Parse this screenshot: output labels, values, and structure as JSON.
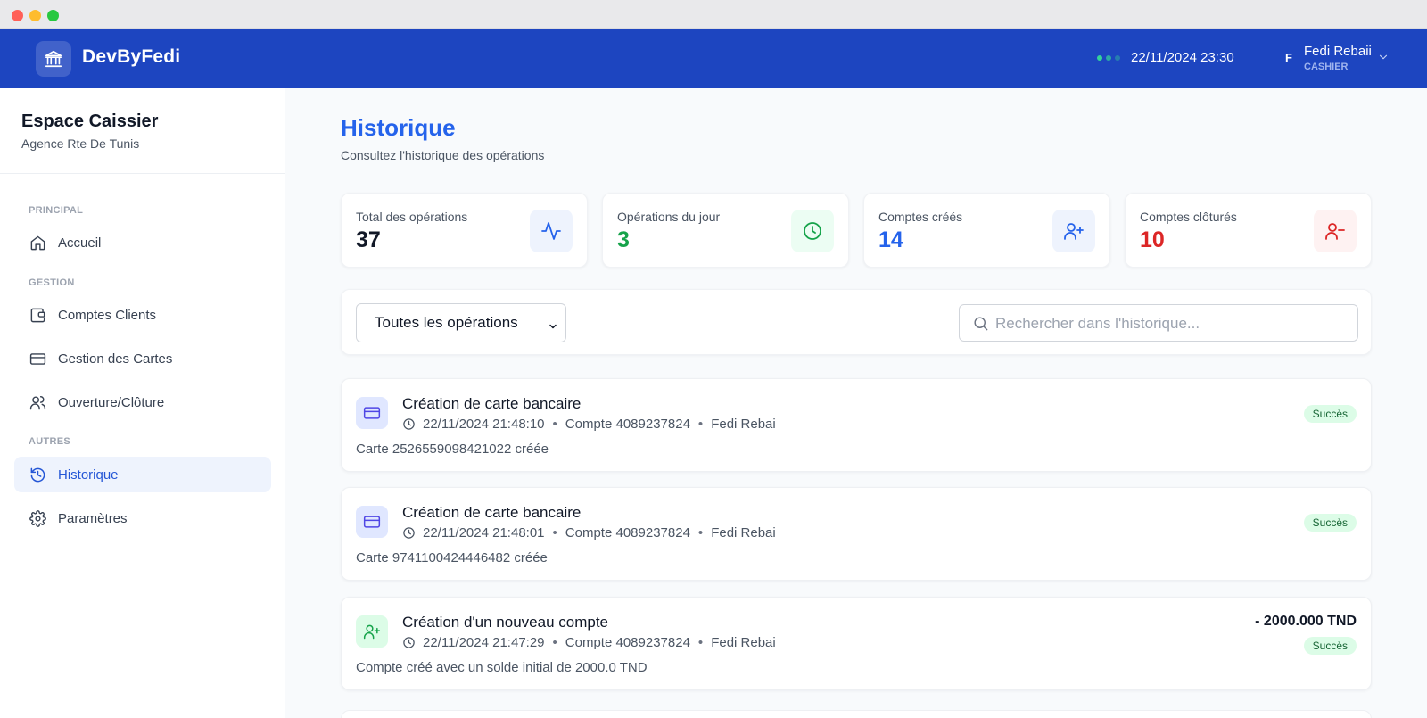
{
  "header": {
    "brand": "DevByFedi",
    "datetime": "22/11/2024 23:30",
    "user_initial": "F",
    "user_name": "Fedi Rebaii",
    "user_role": "CASHIER"
  },
  "sidebar": {
    "title": "Espace Caissier",
    "subtitle": "Agence Rte De Tunis",
    "sections": {
      "principal": "PRINCIPAL",
      "gestion": "GESTION",
      "autres": "AUTRES"
    },
    "items": [
      {
        "label": "Accueil",
        "icon": "home-icon"
      },
      {
        "label": "Comptes Clients",
        "icon": "wallet-icon"
      },
      {
        "label": "Gestion des Cartes",
        "icon": "credit-card-icon"
      },
      {
        "label": "Ouverture/Clôture",
        "icon": "users-icon"
      },
      {
        "label": "Historique",
        "icon": "history-icon",
        "active": true
      },
      {
        "label": "Paramètres",
        "icon": "gear-icon"
      }
    ]
  },
  "page": {
    "title": "Historique",
    "subtitle": "Consultez l'historique des opérations"
  },
  "stats": [
    {
      "label": "Total des opérations",
      "value": "37",
      "icon": "activity-icon",
      "color": "#111827"
    },
    {
      "label": "Opérations du jour",
      "value": "3",
      "icon": "clock-icon",
      "color": "#16a34a"
    },
    {
      "label": "Comptes créés",
      "value": "14",
      "icon": "user-plus-icon",
      "color": "#2563eb"
    },
    {
      "label": "Comptes clôturés",
      "value": "10",
      "icon": "user-minus-icon",
      "color": "#dc2626"
    }
  ],
  "filters": {
    "select_value": "Toutes les opérations",
    "search_placeholder": "Rechercher dans l'historique..."
  },
  "operations": [
    {
      "title": "Création de carte bancaire",
      "datetime": "22/11/2024 21:48:10",
      "account": "Compte 4089237824",
      "user": "Fedi Rebai",
      "description": "Carte 2526559098421022 créée",
      "status": "Succès",
      "icon": "credit-card-icon"
    },
    {
      "title": "Création de carte bancaire",
      "datetime": "22/11/2024 21:48:01",
      "account": "Compte 4089237824",
      "user": "Fedi Rebai",
      "description": "Carte 9741100424446482 créée",
      "status": "Succès",
      "icon": "credit-card-icon"
    },
    {
      "title": "Création d'un nouveau compte",
      "datetime": "22/11/2024 21:47:29",
      "account": "Compte 4089237824",
      "user": "Fedi Rebai",
      "description": "Compte créé avec un solde initial de 2000.0 TND",
      "status": "Succès",
      "amount": "- 2000.000 TND",
      "icon": "user-plus-icon"
    }
  ],
  "colors": {
    "brand": "#1d45c0",
    "accent": "#2563eb",
    "success": "#16a34a",
    "danger": "#dc2626"
  }
}
